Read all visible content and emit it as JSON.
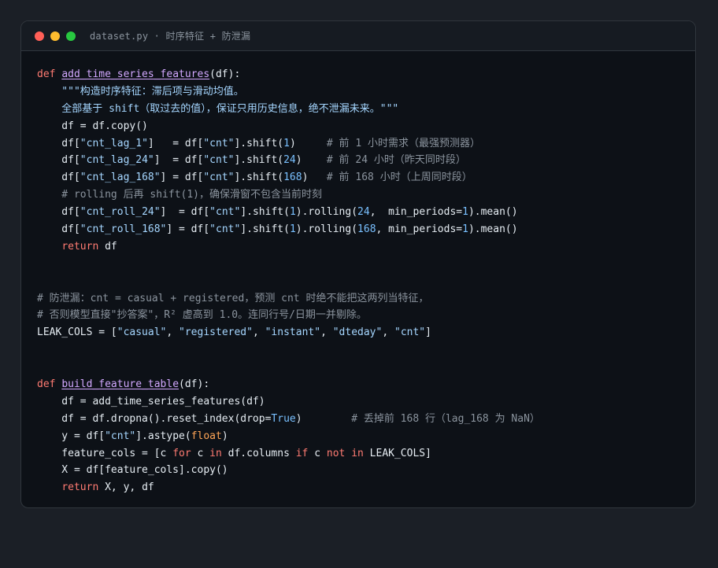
{
  "window": {
    "title": "dataset.py · 时序特征 + 防泄漏",
    "controls": [
      "close",
      "minimize",
      "maximize"
    ]
  },
  "code_lines": [
    [
      {
        "t": "def",
        "c": "kw"
      },
      {
        "t": " ",
        "c": "plain"
      },
      {
        "t": "add_time_series_features",
        "c": "fn"
      },
      {
        "t": "(df):",
        "c": "plain"
      }
    ],
    [
      {
        "t": "    \"\"\"构造时序特征：滞后项与滑动均值。",
        "c": "str"
      }
    ],
    [
      {
        "t": "    全部基于 shift（取过去的值），保证只用历史信息，绝不泄漏未来。\"\"\"",
        "c": "str"
      }
    ],
    [
      {
        "t": "    df = df.copy()",
        "c": "plain"
      }
    ],
    [
      {
        "t": "    df[",
        "c": "plain"
      },
      {
        "t": "\"cnt_lag_1\"",
        "c": "str"
      },
      {
        "t": "]   = df[",
        "c": "plain"
      },
      {
        "t": "\"cnt\"",
        "c": "str"
      },
      {
        "t": "].shift(",
        "c": "plain"
      },
      {
        "t": "1",
        "c": "num"
      },
      {
        "t": ")     ",
        "c": "plain"
      },
      {
        "t": "# 前 1 小时需求（最强预测器）",
        "c": "cm"
      }
    ],
    [
      {
        "t": "    df[",
        "c": "plain"
      },
      {
        "t": "\"cnt_lag_24\"",
        "c": "str"
      },
      {
        "t": "]  = df[",
        "c": "plain"
      },
      {
        "t": "\"cnt\"",
        "c": "str"
      },
      {
        "t": "].shift(",
        "c": "plain"
      },
      {
        "t": "24",
        "c": "num"
      },
      {
        "t": ")    ",
        "c": "plain"
      },
      {
        "t": "# 前 24 小时（昨天同时段）",
        "c": "cm"
      }
    ],
    [
      {
        "t": "    df[",
        "c": "plain"
      },
      {
        "t": "\"cnt_lag_168\"",
        "c": "str"
      },
      {
        "t": "] = df[",
        "c": "plain"
      },
      {
        "t": "\"cnt\"",
        "c": "str"
      },
      {
        "t": "].shift(",
        "c": "plain"
      },
      {
        "t": "168",
        "c": "num"
      },
      {
        "t": ")   ",
        "c": "plain"
      },
      {
        "t": "# 前 168 小时（上周同时段）",
        "c": "cm"
      }
    ],
    [
      {
        "t": "    # rolling 后再 shift(1)，确保滑窗不包含当前时刻",
        "c": "cm"
      }
    ],
    [
      {
        "t": "    df[",
        "c": "plain"
      },
      {
        "t": "\"cnt_roll_24\"",
        "c": "str"
      },
      {
        "t": "]  = df[",
        "c": "plain"
      },
      {
        "t": "\"cnt\"",
        "c": "str"
      },
      {
        "t": "].shift(",
        "c": "plain"
      },
      {
        "t": "1",
        "c": "num"
      },
      {
        "t": ").rolling(",
        "c": "plain"
      },
      {
        "t": "24",
        "c": "num"
      },
      {
        "t": ",  min_periods=",
        "c": "plain"
      },
      {
        "t": "1",
        "c": "num"
      },
      {
        "t": ").mean()",
        "c": "plain"
      }
    ],
    [
      {
        "t": "    df[",
        "c": "plain"
      },
      {
        "t": "\"cnt_roll_168\"",
        "c": "str"
      },
      {
        "t": "] = df[",
        "c": "plain"
      },
      {
        "t": "\"cnt\"",
        "c": "str"
      },
      {
        "t": "].shift(",
        "c": "plain"
      },
      {
        "t": "1",
        "c": "num"
      },
      {
        "t": ").rolling(",
        "c": "plain"
      },
      {
        "t": "168",
        "c": "num"
      },
      {
        "t": ", min_periods=",
        "c": "plain"
      },
      {
        "t": "1",
        "c": "num"
      },
      {
        "t": ").mean()",
        "c": "plain"
      }
    ],
    [
      {
        "t": "    ",
        "c": "plain"
      },
      {
        "t": "return",
        "c": "kw"
      },
      {
        "t": " df",
        "c": "plain"
      }
    ],
    [],
    [],
    [
      {
        "t": "# 防泄漏：cnt = casual + registered，预测 cnt 时绝不能把这两列当特征，",
        "c": "cm"
      }
    ],
    [
      {
        "t": "# 否则模型直接\"抄答案\"，R² 虚高到 1.0。连同行号/日期一并剔除。",
        "c": "cm"
      }
    ],
    [
      {
        "t": "LEAK_COLS = [",
        "c": "plain"
      },
      {
        "t": "\"casual\"",
        "c": "str"
      },
      {
        "t": ", ",
        "c": "plain"
      },
      {
        "t": "\"registered\"",
        "c": "str"
      },
      {
        "t": ", ",
        "c": "plain"
      },
      {
        "t": "\"instant\"",
        "c": "str"
      },
      {
        "t": ", ",
        "c": "plain"
      },
      {
        "t": "\"dteday\"",
        "c": "str"
      },
      {
        "t": ", ",
        "c": "plain"
      },
      {
        "t": "\"cnt\"",
        "c": "str"
      },
      {
        "t": "]",
        "c": "plain"
      }
    ],
    [],
    [],
    [
      {
        "t": "def",
        "c": "kw"
      },
      {
        "t": " ",
        "c": "plain"
      },
      {
        "t": "build_feature_table",
        "c": "fn"
      },
      {
        "t": "(df):",
        "c": "plain"
      }
    ],
    [
      {
        "t": "    df = add_time_series_features(df)",
        "c": "plain"
      }
    ],
    [
      {
        "t": "    df = df.dropna().reset_index(drop=",
        "c": "plain"
      },
      {
        "t": "True",
        "c": "num"
      },
      {
        "t": ")        ",
        "c": "plain"
      },
      {
        "t": "# 丢掉前 168 行（lag_168 为 NaN）",
        "c": "cm"
      }
    ],
    [
      {
        "t": "    y = df[",
        "c": "plain"
      },
      {
        "t": "\"cnt\"",
        "c": "str"
      },
      {
        "t": "].astype(",
        "c": "plain"
      },
      {
        "t": "float",
        "c": "bi"
      },
      {
        "t": ")",
        "c": "plain"
      }
    ],
    [
      {
        "t": "    feature_cols = [c ",
        "c": "plain"
      },
      {
        "t": "for",
        "c": "kw"
      },
      {
        "t": " c ",
        "c": "plain"
      },
      {
        "t": "in",
        "c": "kw"
      },
      {
        "t": " df.columns ",
        "c": "plain"
      },
      {
        "t": "if",
        "c": "kw"
      },
      {
        "t": " c ",
        "c": "plain"
      },
      {
        "t": "not",
        "c": "kw"
      },
      {
        "t": " ",
        "c": "plain"
      },
      {
        "t": "in",
        "c": "kw"
      },
      {
        "t": " LEAK_COLS]",
        "c": "plain"
      }
    ],
    [
      {
        "t": "    X = df[feature_cols].copy()",
        "c": "plain"
      }
    ],
    [
      {
        "t": "    ",
        "c": "plain"
      },
      {
        "t": "return",
        "c": "kw"
      },
      {
        "t": " X, y, df",
        "c": "plain"
      }
    ]
  ]
}
